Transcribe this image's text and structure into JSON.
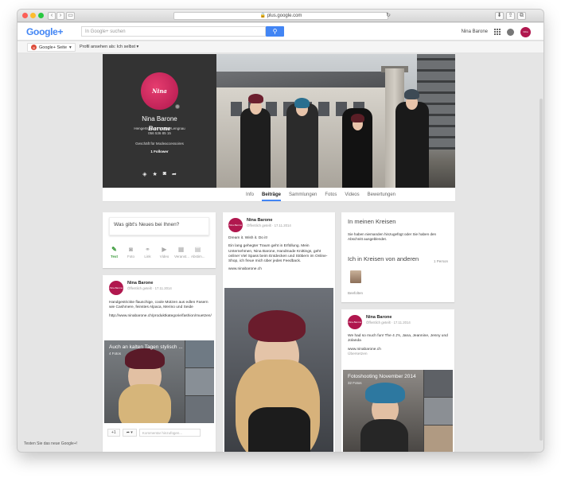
{
  "browser": {
    "url": "plus.google.com"
  },
  "gbar": {
    "logo": "Google+",
    "search_placeholder": "In Google+ suchen",
    "user_name": "Nina Barone",
    "avatar_text": "Nina Barone"
  },
  "subbar": {
    "page_selector": "Google+ Seite",
    "view_as": "Profil ansehen als: Ich selbst"
  },
  "profile": {
    "logo_text": "Nina Barone",
    "name": "Nina Barone",
    "address": "Hengertstrasse 8 5426 Lengnau",
    "phone": "056 536 85 15",
    "category": "Geschäft für Modeaccessoires",
    "followers": "1 Follower"
  },
  "tabs": [
    {
      "label": "Info"
    },
    {
      "label": "Beiträge",
      "active": true
    },
    {
      "label": "Sammlungen"
    },
    {
      "label": "Fotos"
    },
    {
      "label": "Videos"
    },
    {
      "label": "Bewertungen"
    }
  ],
  "share": {
    "placeholder": "Was gibt's Neues bei Ihnen?",
    "actions": [
      "Text",
      "Foto",
      "Link",
      "Video",
      "Veranst...",
      "Abstim..."
    ]
  },
  "post1": {
    "author": "Nina Barone",
    "visibility": "Öffentlich geteilt",
    "date": "17.11.2014",
    "text1": "Handgestrickte flauschige, coole Mützen aus edlen Fasern wie Cashmere, feinstes Alpaca, Merino und Seide",
    "text2": "http://www.ninabarone.ch/produktkategorie/fashion/muetzen/",
    "album_title": "Auch an kalten Tagen stylisch ...",
    "album_count": "4 Fotos",
    "plus_one": "+1",
    "comment_placeholder": "Kommentar hinzufügen..."
  },
  "post2": {
    "author": "Nina Barone",
    "visibility": "Öffentlich geteilt",
    "date": "17.11.2014",
    "text1": "Dream it. Wish it. Do it!",
    "text2": "Ein lang gehegter Traum geht in Erfüllung. Mein Unternehmen, Nina Barone, Handmade Knittings, geht online! Viel Spass beim Entdecken und Stöbern im Online-Shop, ich freue mich über jedes Feedback.",
    "text3": "www.ninabarone.ch"
  },
  "circles": {
    "title1": "In meinen Kreisen",
    "text1": "Sie haben niemanden hinzugefügt oder Sie haben den Abschnitt ausgeblendet.",
    "title2": "Ich in Kreisen von anderen",
    "count": "1 Person",
    "follow": "Beefolten"
  },
  "post3": {
    "author": "Nina Barone",
    "visibility": "Öffentlich geteilt",
    "date": "17.11.2014",
    "text1": "We had so much fun! The 4 J's, Jana, Jeannine, Jenny und Jolanda",
    "text2": "www.ninabarone.ch",
    "translate": "Übersetzen",
    "album_title": "Fotoshooting November 2014",
    "album_count": "32 Fotos"
  },
  "footer": {
    "new_google": "Testen Sie das neue Google+!"
  },
  "colors": {
    "brand": "#b0174e",
    "google_blue": "#4285f4",
    "green_active": "#3a9a3a"
  }
}
